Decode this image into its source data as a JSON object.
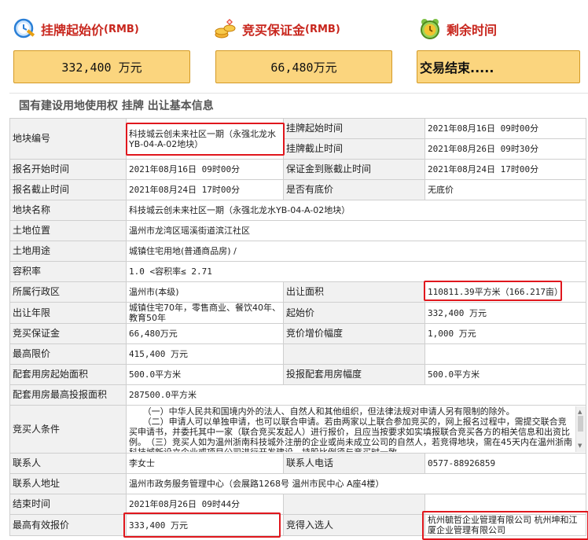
{
  "header": {
    "start_price": {
      "title": "挂牌起始价",
      "unit": "(RMB)",
      "value": "332,400 万元",
      "icon": "clock-pen-icon"
    },
    "deposit": {
      "title": "竞买保证金",
      "unit": "(RMB)",
      "value": "66,480万元",
      "icon": "coins-icon"
    },
    "remaining": {
      "title": "剩余时间",
      "value": "交易结束.....",
      "icon": "alarm-clock-icon"
    }
  },
  "section_title": "国有建设用地使用权 挂牌 出让基本信息",
  "rows": {
    "parcel_no": {
      "label": "地块编号",
      "value": "科技城云创未来社区一期（永强北龙水YB-04-A-02地块）"
    },
    "listing_start": {
      "label": "挂牌起始时间",
      "value": "2021年08月16日 09时00分"
    },
    "listing_end": {
      "label": "挂牌截止时间",
      "value": "2021年08月26日 09时30分"
    },
    "signup_start": {
      "label": "报名开始时间",
      "value": "2021年08月16日 09时00分"
    },
    "deposit_deadline": {
      "label": "保证金到账截止时间",
      "value": "2021年08月24日 17时00分"
    },
    "signup_end": {
      "label": "报名截止时间",
      "value": "2021年08月24日 17时00分"
    },
    "reserve_price": {
      "label": "是否有底价",
      "value": "无底价"
    },
    "parcel_name": {
      "label": "地块名称",
      "value": "科技城云创未来社区一期（永强北龙水YB-04-A-02地块）"
    },
    "location": {
      "label": "土地位置",
      "value": "温州市龙湾区瑶溪街道滨江社区"
    },
    "usage": {
      "label": "土地用途",
      "value": "城镇住宅用地(普通商品房) /"
    },
    "far": {
      "label": "容积率",
      "value": "1.0 <容积率≤ 2.71"
    },
    "district": {
      "label": "所属行政区",
      "value": "温州市(本级)"
    },
    "area": {
      "label": "出让面积",
      "value": "110811.39平方米（166.217亩）"
    },
    "term": {
      "label": "出让年限",
      "value": "城镇住宅70年，零售商业、餐饮40年、教育50年"
    },
    "start_price": {
      "label": "起始价",
      "value": "332,400 万元"
    },
    "deposit": {
      "label": "竞买保证金",
      "value": "66,480万元"
    },
    "increment": {
      "label": "竞价增价幅度",
      "value": "1,000 万元"
    },
    "max_price": {
      "label": "最高限价",
      "value": "415,400 万元"
    },
    "housing_start_area": {
      "label": "配套用房起始面积",
      "value": "500.0平方米"
    },
    "housing_increment": {
      "label": "投报配套用房幅度",
      "value": "500.0平方米"
    },
    "housing_max_area": {
      "label": "配套用房最高投报面积",
      "value": "287500.0平方米"
    },
    "bidder_conditions": {
      "label": "竞买人条件",
      "paragraphs": [
        "（一）中华人民共和国境内外的法人、自然人和其他组织，但法律法规对申请人另有限制的除外。",
        "（二）申请人可以单独申请，也可以联合申请。若由两家以上联合参加竞买的，网上报名过程中，需提交联合竞买申请书，并委托其中一家（联合竞买发起人）进行报价，且应当按要求如实填报联合竞买各方的相关信息和出资比例。　（三）竞买人如为温州浙南科技城外注册的企业或尚未成立公司的自然人，若竞得地块，需在45天内在温州浙南科技城新设立企业或项目公司进行开发建设，持股比例须与竞买时一致。"
      ]
    },
    "contact": {
      "label": "联系人",
      "value": "李女士"
    },
    "phone": {
      "label": "联系人电话",
      "value": "0577-88926859"
    },
    "address": {
      "label": "联系人地址",
      "value": "温州市政务服务管理中心（会展路1268号 温州市民中心 A座4楼）"
    },
    "end_time": {
      "label": "结束时间",
      "value": "2021年08月26日 09时44分"
    },
    "highest_bid": {
      "label": "最高有效报价",
      "value": "333,400 万元"
    },
    "winner": {
      "label": "竞得入选人",
      "value": "杭州毓哲企业管理有限公司 杭州坤和江厦企业管理有限公司"
    }
  },
  "colors": {
    "accent_red": "#c8261d",
    "box_fill": "#fbd57e",
    "highlight": "#e0171d"
  }
}
